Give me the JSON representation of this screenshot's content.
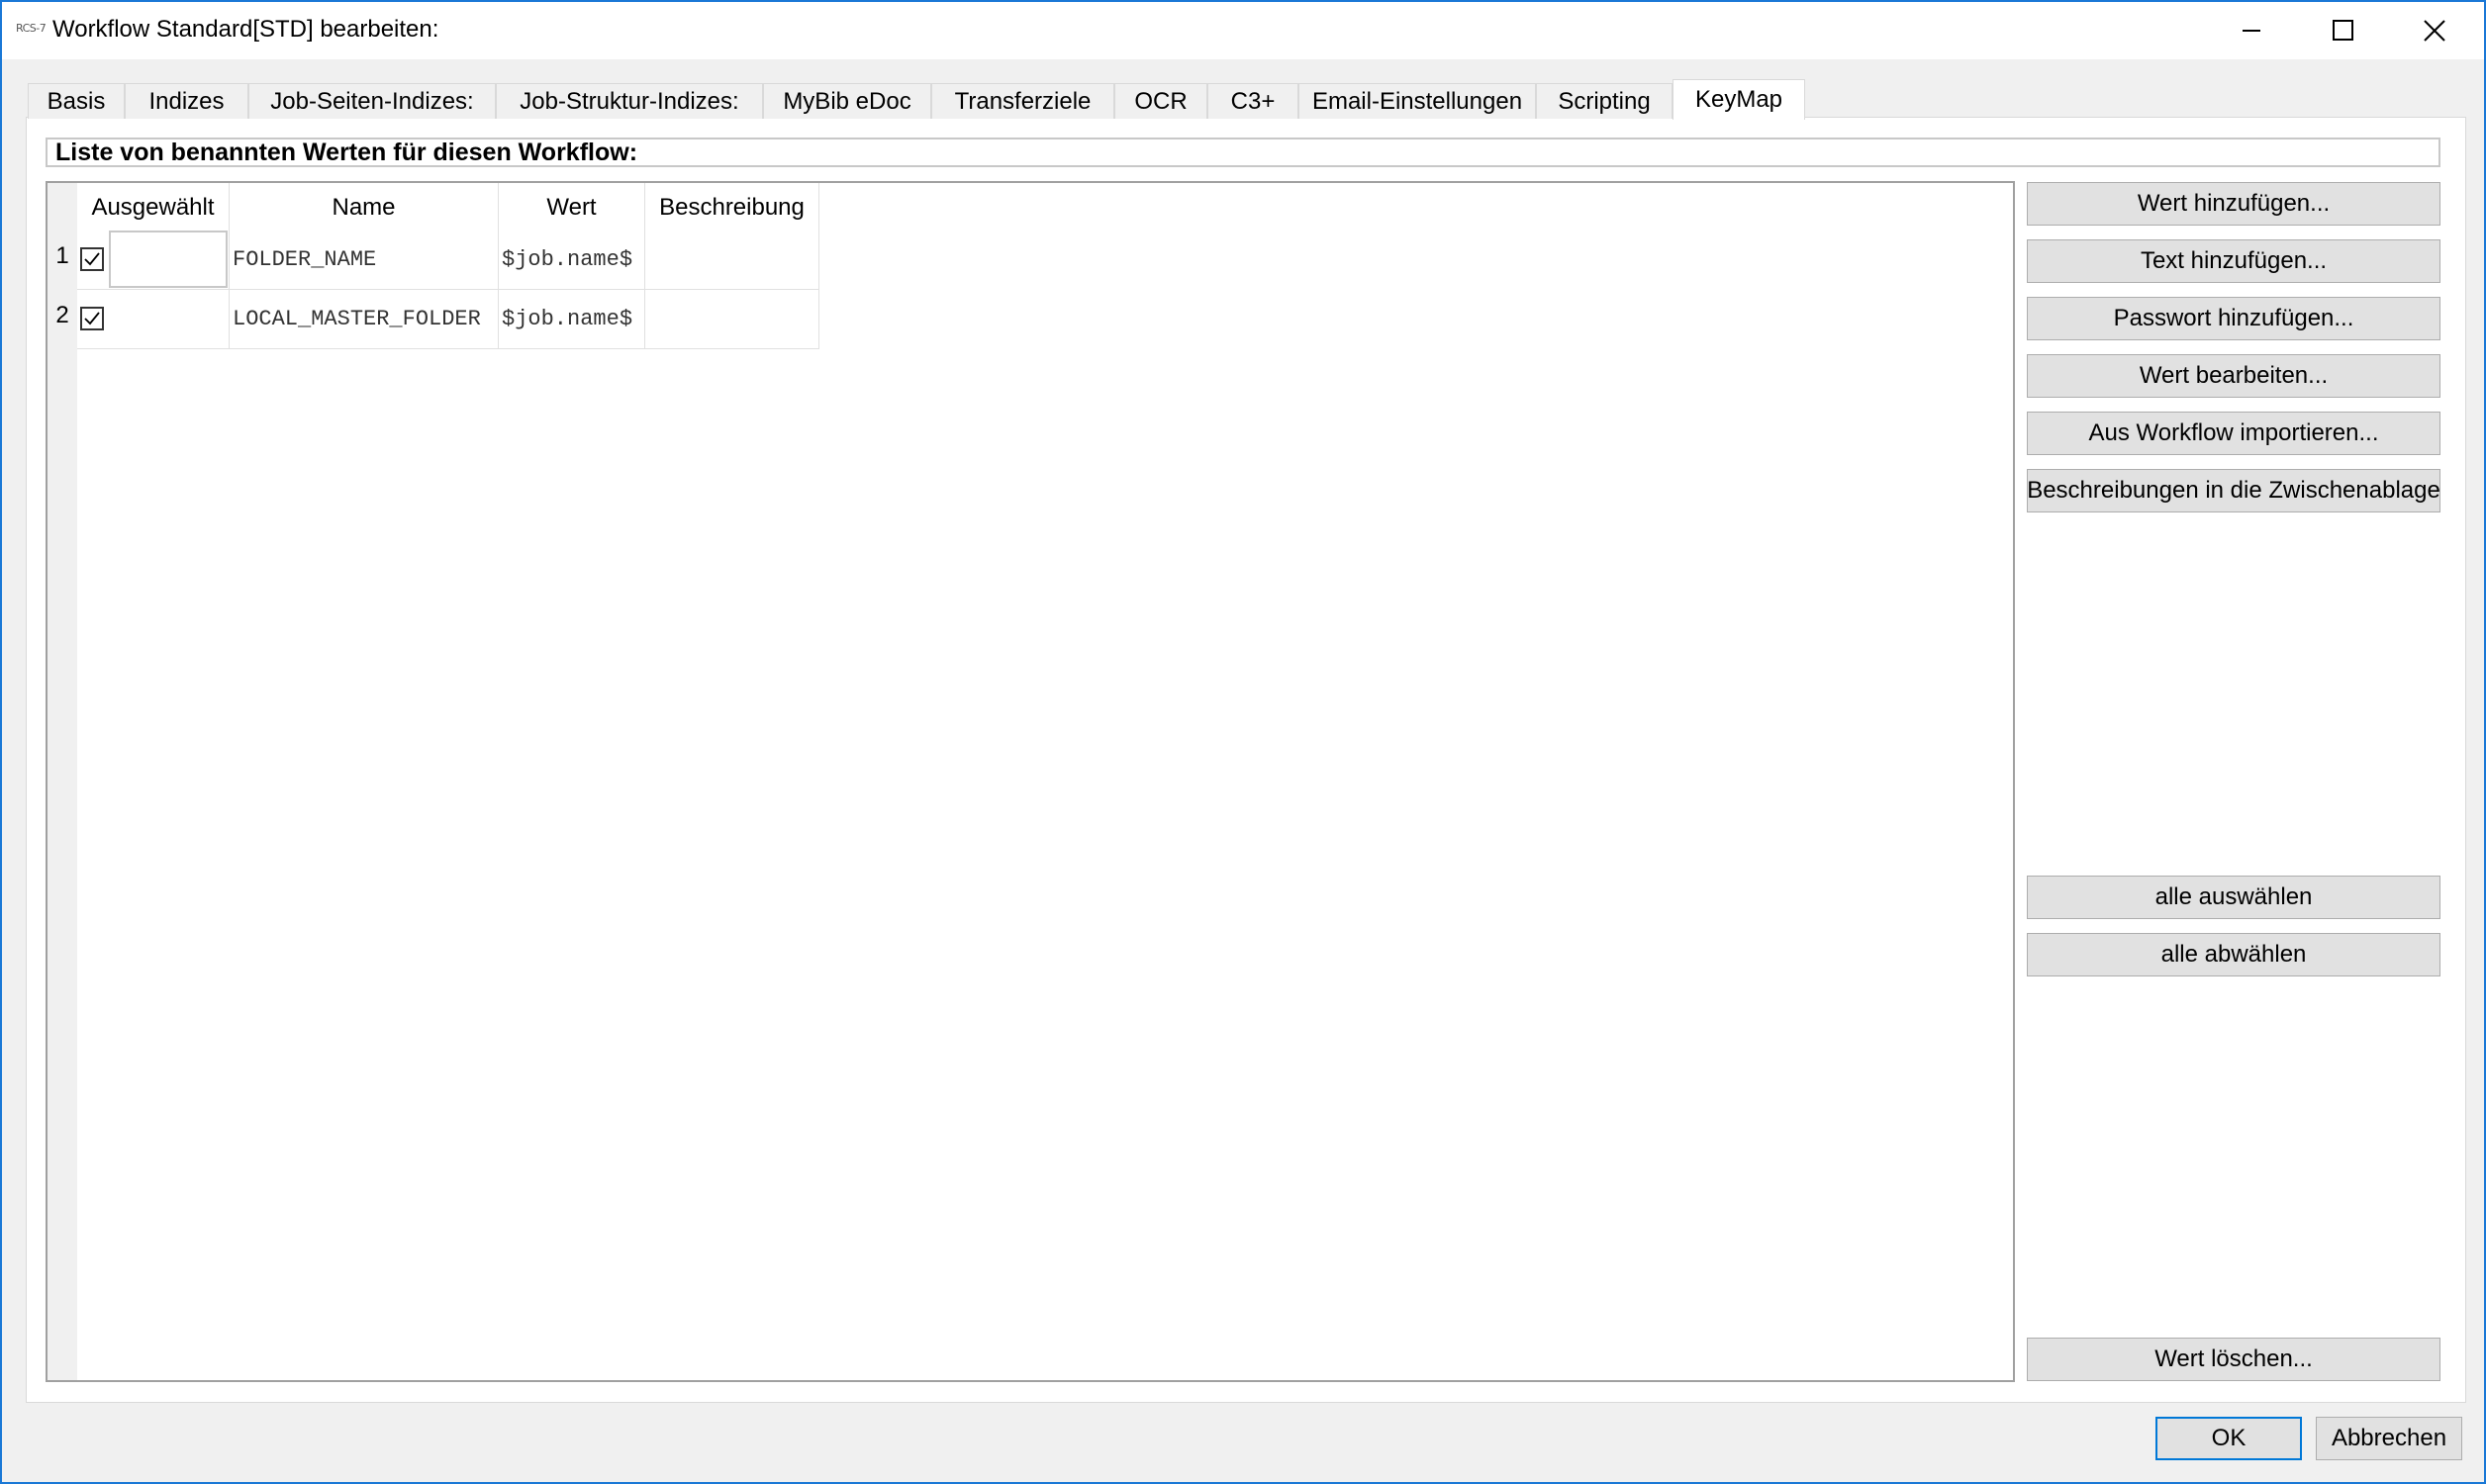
{
  "window": {
    "app_icon_text": "RCS-7",
    "title": "Workflow Standard[STD] bearbeiten:"
  },
  "tabs": [
    {
      "label": "Basis"
    },
    {
      "label": "Indizes"
    },
    {
      "label": "Job-Seiten-Indizes:"
    },
    {
      "label": "Job-Struktur-Indizes:"
    },
    {
      "label": "MyBib eDoc"
    },
    {
      "label": "Transferziele"
    },
    {
      "label": "OCR"
    },
    {
      "label": "C3+"
    },
    {
      "label": "Email-Einstellungen"
    },
    {
      "label": "Scripting"
    },
    {
      "label": "KeyMap",
      "active": true
    }
  ],
  "keymap": {
    "list_header": "Liste von benannten Werten für diesen Workflow:",
    "columns": [
      "Ausgewählt",
      "Name",
      "Wert",
      "Beschreibung"
    ],
    "rows": [
      {
        "num": "1",
        "checked": true,
        "name": "FOLDER_NAME",
        "value": "$job.name$",
        "description": ""
      },
      {
        "num": "2",
        "checked": true,
        "name": "LOCAL_MASTER_FOLDER",
        "value": "$job.name$",
        "description": ""
      }
    ]
  },
  "side_buttons": {
    "add_value": "Wert hinzufügen...",
    "add_text": "Text hinzufügen...",
    "add_password": "Passwort hinzufügen...",
    "edit_value": "Wert bearbeiten...",
    "import_workflow": "Aus Workflow importieren...",
    "copy_descriptions": "Beschreibungen in die Zwischenablage",
    "select_all": "alle auswählen",
    "deselect_all": "alle abwählen",
    "delete_value": "Wert löschen..."
  },
  "dialog_buttons": {
    "ok": "OK",
    "cancel": "Abbrechen"
  },
  "colors": {
    "window_border": "#1a78d6",
    "default_button_border": "#0078d7",
    "button_face": "#e1e1e1",
    "dialog_bg": "#f0f0f0"
  }
}
